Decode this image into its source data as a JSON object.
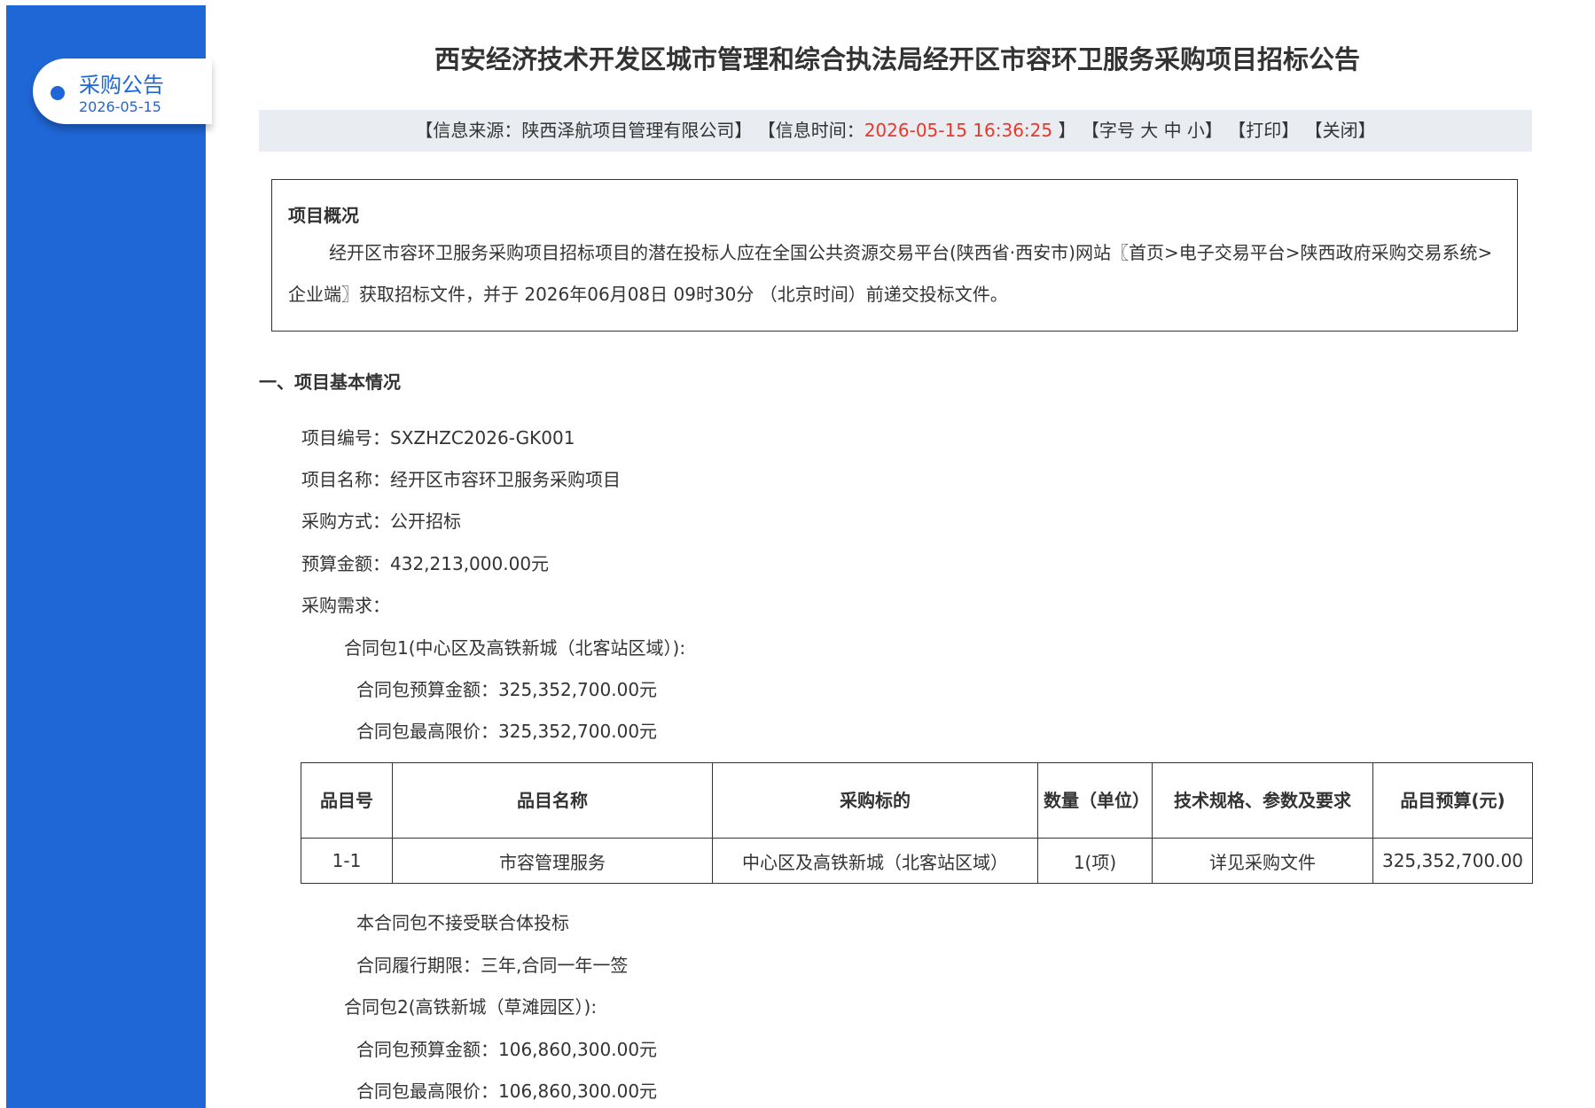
{
  "sidebar": {
    "label": "采购公告",
    "date": "2026-05-15"
  },
  "title": "西安经济技术开发区城市管理和综合执法局经开区市容环卫服务采购项目招标公告",
  "info_bar": {
    "source": "【信息来源：陕西泽航项目管理有限公司】",
    "time_label": "【信息时间：",
    "time_value": "2026-05-15 16:36:25",
    "time_close": "】",
    "font_label": "【字号",
    "font_large": "大",
    "font_medium": "中",
    "font_small": "小",
    "font_close": "】",
    "print": "【打印】",
    "close": "【关闭】"
  },
  "overview": {
    "heading": "项目概况",
    "text": "经开区市容环卫服务采购项目招标项目的潜在投标人应在全国公共资源交易平台(陕西省·西安市)网站〖首页>电子交易平台>陕西政府采购交易系统>企业端〗获取招标文件，并于 2026年06月08日 09时30分 （北京时间）前递交投标文件。"
  },
  "section1": {
    "heading": "一、项目基本情况",
    "project_no": "项目编号：SXZHZC2026-GK001",
    "project_name": "项目名称：经开区市容环卫服务采购项目",
    "method": "采购方式：公开招标",
    "budget": "预算金额：432,213,000.00元",
    "requirements": "采购需求：",
    "package1": {
      "title": "合同包1(中心区及高铁新城（北客站区域）):",
      "budget": "合同包预算金额：325,352,700.00元",
      "max_price": "合同包最高限价：325,352,700.00元",
      "no_consortium": "本合同包不接受联合体投标",
      "period": "合同履行期限：三年,合同一年一签"
    },
    "package2": {
      "title": "合同包2(高铁新城（草滩园区）):",
      "budget": "合同包预算金额：106,860,300.00元",
      "max_price": "合同包最高限价：106,860,300.00元"
    }
  },
  "table": {
    "headers": [
      "品目号",
      "品目名称",
      "采购标的",
      "数量（单位）",
      "技术规格、参数及要求",
      "品目预算(元)"
    ],
    "rows": [
      [
        "1-1",
        "市容管理服务",
        "中心区及高铁新城（北客站区域）",
        "1(项)",
        "详见采购文件",
        "325,352,700.00"
      ]
    ]
  }
}
